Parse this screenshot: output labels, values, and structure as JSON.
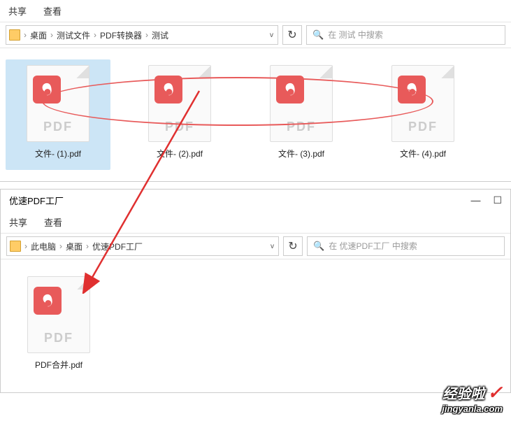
{
  "window1": {
    "tabs": {
      "share": "共享",
      "view": "查看"
    },
    "breadcrumb": [
      "桌面",
      "测试文件",
      "PDF转换器",
      "测试"
    ],
    "search_placeholder": "在 测试 中搜索",
    "files": [
      {
        "name": "文件- (1).pdf",
        "selected": true
      },
      {
        "name": "文件- (2).pdf",
        "selected": false
      },
      {
        "name": "文件- (3).pdf",
        "selected": false
      },
      {
        "name": "文件- (4).pdf",
        "selected": false
      }
    ]
  },
  "window2": {
    "title": "优速PDF工厂",
    "tabs": {
      "share": "共享",
      "view": "查看"
    },
    "breadcrumb": [
      "此电脑",
      "桌面",
      "优速PDF工厂"
    ],
    "search_placeholder": "在 优速PDF工厂 中搜索",
    "files": [
      {
        "name": "PDF合并.pdf",
        "selected": false
      }
    ]
  },
  "pdf_label": "PDF",
  "watermark": {
    "main": "经验啦",
    "sub": "jingyanla.com"
  }
}
